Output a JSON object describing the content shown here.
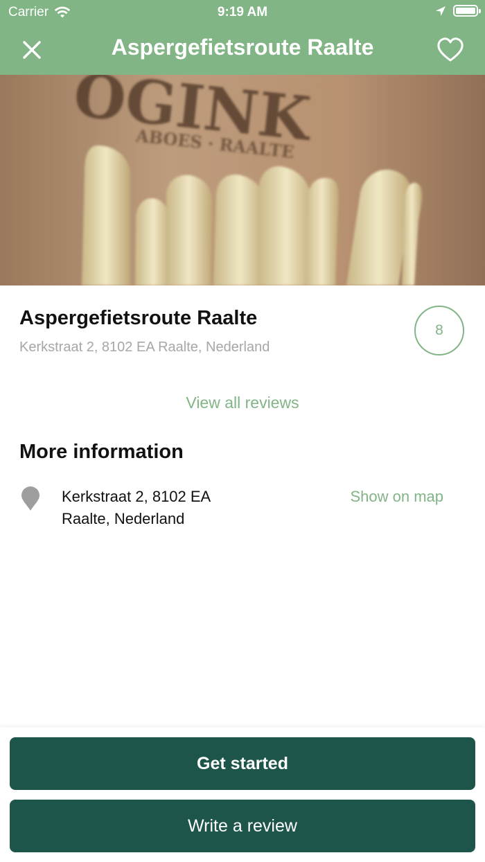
{
  "status_bar": {
    "carrier": "Carrier",
    "time": "9:19 AM"
  },
  "nav": {
    "title": "Aspergefietsroute Raalte",
    "close_icon": "close-icon",
    "favorite_icon": "heart-icon"
  },
  "hero": {
    "sign_text_main": "OGINK",
    "sign_text_sub": "ABOES · RAALTE"
  },
  "place": {
    "title": "Aspergefietsroute Raalte",
    "address": "Kerkstraat 2, 8102 EA Raalte, Nederland",
    "score": "8",
    "view_reviews": "View all reviews"
  },
  "more_info": {
    "heading": "More information",
    "address_line1": "Kerkstraat 2, 8102 EA",
    "address_line2": "Raalte, Nederland",
    "show_on_map": "Show on map"
  },
  "actions": {
    "get_started": "Get started",
    "write_review": "Write a review"
  },
  "colors": {
    "accent_green": "#82b585",
    "button_dark_green": "#1e554a"
  }
}
